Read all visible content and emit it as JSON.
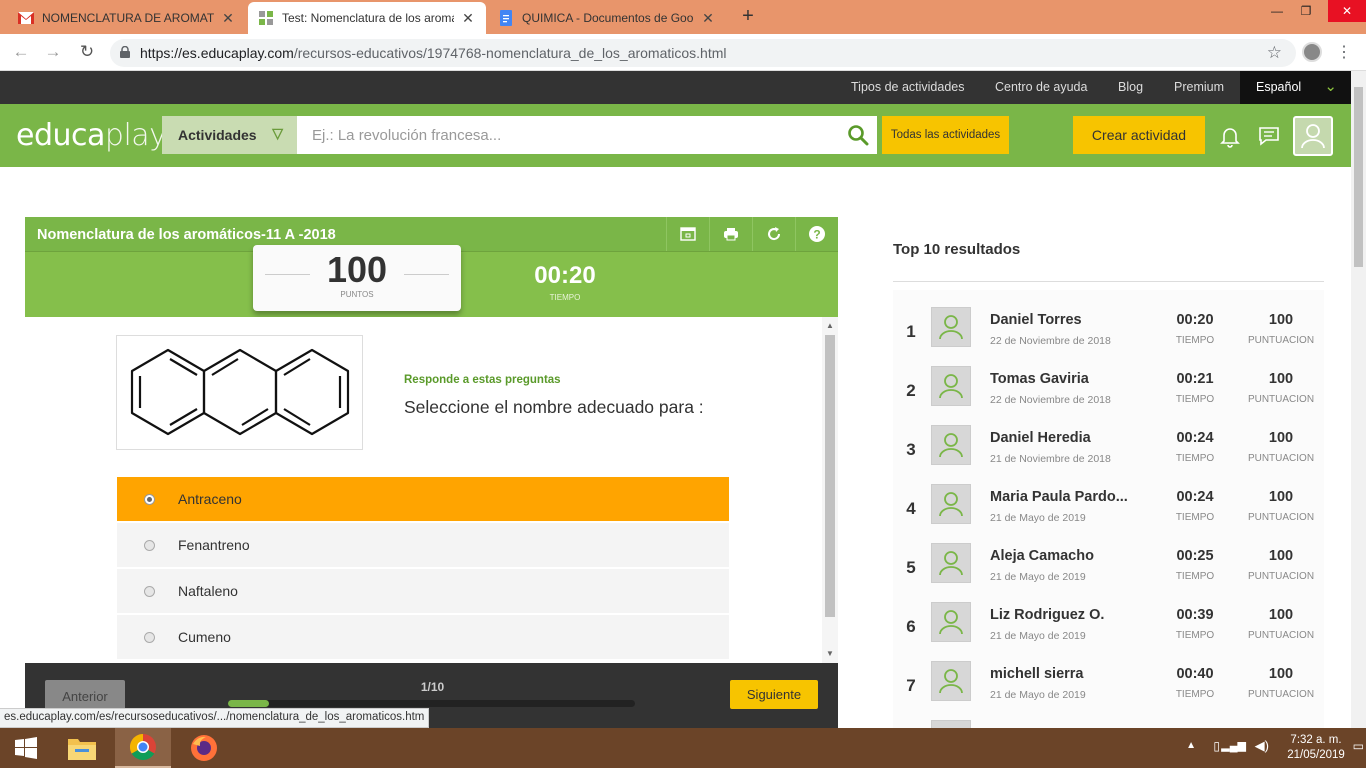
{
  "browser": {
    "tabs": [
      {
        "title": "NOMENCLATURA DE AROMATIC",
        "icon": "gmail-icon",
        "active": false
      },
      {
        "title": "Test: Nomenclatura de los aromá",
        "icon": "educaplay-icon",
        "active": true
      },
      {
        "title": "QUIMICA - Documentos de Goo",
        "icon": "google-docs-icon",
        "active": false
      }
    ],
    "url_host": "https://es.educaplay.com",
    "url_path": "/recursos-educativos/1974768-nomenclatura_de_los_aromaticos.html",
    "status_link": "es.educaplay.com/es/recursoseducativos/.../nomenclatura_de_los_aromaticos.htm"
  },
  "topnav": {
    "items": [
      "Tipos de actividades",
      "Centro de ayuda",
      "Blog",
      "Premium"
    ],
    "language": "Español"
  },
  "header": {
    "logo_a": "educa",
    "logo_b": "play",
    "activities_label": "Actividades",
    "search_placeholder": "Ej.: La revolución francesa...",
    "all_activities": "Todas las actividades",
    "create_activity": "Crear actividad"
  },
  "game": {
    "title": "Nomenclatura de los aromáticos-11 A -2018",
    "points": "100",
    "points_label": "PUNTOS",
    "time": "00:20",
    "time_label": "TIEMPO",
    "hint": "Responde a estas preguntas",
    "question": "Seleccione el nombre adecuado para :",
    "options": [
      {
        "label": "Antraceno",
        "selected": true
      },
      {
        "label": "Fenantreno",
        "selected": false
      },
      {
        "label": "Naftaleno",
        "selected": false
      },
      {
        "label": "Cumeno",
        "selected": false
      }
    ],
    "prev_label": "Anterior",
    "next_label": "Siguiente",
    "page_indicator": "1/10",
    "progress_fraction": 0.1
  },
  "leaderboard": {
    "title": "Top 10 resultados",
    "time_label": "TIEMPO",
    "score_label": "PUNTUACION",
    "rows": [
      {
        "rank": "1",
        "name": "Daniel Torres",
        "date": "22 de Noviembre de 2018",
        "time": "00:20",
        "score": "100"
      },
      {
        "rank": "2",
        "name": "Tomas Gaviria",
        "date": "22 de Noviembre de 2018",
        "time": "00:21",
        "score": "100"
      },
      {
        "rank": "3",
        "name": "Daniel Heredia",
        "date": "21 de Noviembre de 2018",
        "time": "00:24",
        "score": "100"
      },
      {
        "rank": "4",
        "name": "Maria Paula Pardo...",
        "date": "21 de Mayo de 2019",
        "time": "00:24",
        "score": "100"
      },
      {
        "rank": "5",
        "name": "Aleja Camacho",
        "date": "21 de Mayo de 2019",
        "time": "00:25",
        "score": "100"
      },
      {
        "rank": "6",
        "name": "Liz Rodriguez O.",
        "date": "21 de Mayo de 2019",
        "time": "00:39",
        "score": "100"
      },
      {
        "rank": "7",
        "name": "michell sierra",
        "date": "21 de Mayo de 2019",
        "time": "00:40",
        "score": "100"
      }
    ]
  },
  "taskbar": {
    "time": "7:32 a. m.",
    "date": "21/05/2019"
  },
  "colors": {
    "brand_green": "#7ab648",
    "selected_option": "#ffa400",
    "yellow_button": "#f7c400",
    "tabstrip": "#e8956b",
    "taskbar": "#6b4428"
  }
}
